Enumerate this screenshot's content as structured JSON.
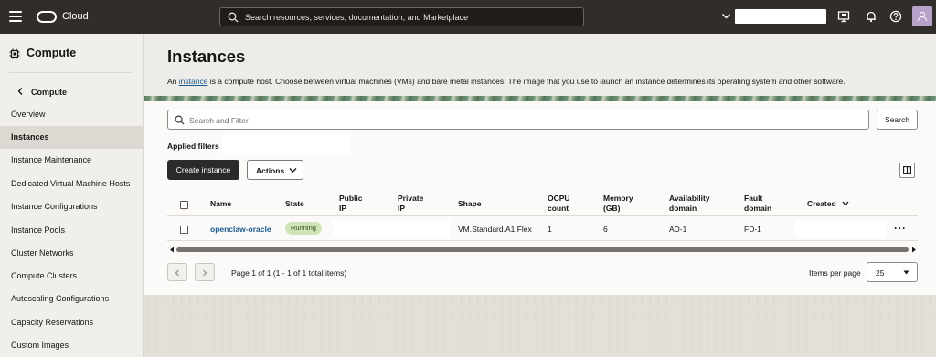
{
  "topbar": {
    "brand": "Cloud",
    "search_placeholder": "Search resources, services, documentation, and Marketplace"
  },
  "sidebar": {
    "title": "Compute",
    "back_label": "Compute",
    "items": [
      {
        "label": "Overview"
      },
      {
        "label": "Instances",
        "active": true
      },
      {
        "label": "Instance Maintenance"
      },
      {
        "label": "Dedicated Virtual Machine Hosts"
      },
      {
        "label": "Instance Configurations"
      },
      {
        "label": "Instance Pools"
      },
      {
        "label": "Cluster Networks"
      },
      {
        "label": "Compute Clusters"
      },
      {
        "label": "Autoscaling Configurations"
      },
      {
        "label": "Capacity Reservations"
      },
      {
        "label": "Custom Images"
      }
    ]
  },
  "main": {
    "title": "Instances",
    "desc_prefix": "An ",
    "desc_link": "instance",
    "desc_suffix": " is a compute host. Choose between virtual machines (VMs) and bare metal instances. The image that you use to launch an instance determines its operating system and other software.",
    "filter_placeholder": "Search and Filter",
    "search_button": "Search",
    "applied_filters_label": "Applied filters",
    "create_button": "Create instance",
    "actions_button": "Actions"
  },
  "table": {
    "headers": {
      "name": "Name",
      "state": "State",
      "public_ip_1": "Public",
      "public_ip_2": "IP",
      "private_ip_1": "Private",
      "private_ip_2": "IP",
      "shape": "Shape",
      "ocpu_1": "OCPU",
      "ocpu_2": "count",
      "memory_1": "Memory",
      "memory_2": "(GB)",
      "ad_1": "Availability",
      "ad_2": "domain",
      "fd_1": "Fault",
      "fd_2": "domain",
      "created": "Created"
    },
    "rows": [
      {
        "name": "openclaw-oracle",
        "state": "Running",
        "shape": "VM.Standard.A1.Flex",
        "ocpu": "1",
        "memory": "6",
        "ad": "AD-1",
        "fd": "FD-1",
        "menu": "···"
      }
    ]
  },
  "pagination": {
    "text": "Page 1 of 1 (1 - 1 of 1 total items)",
    "items_per_page_label": "Items per page",
    "items_per_page_value": "25"
  },
  "colors": {
    "topbar": "#312d2a",
    "primary_button": "#2c2a28",
    "link": "#1b5a8f",
    "running_badge": "#cfe4b8"
  },
  "icons": [
    "menu-icon",
    "oracle-logo-icon",
    "search-icon",
    "chevron-down-icon",
    "console-icon",
    "bell-icon",
    "help-icon",
    "avatar-icon",
    "compute-icon",
    "chevron-left-icon",
    "panel-icon",
    "ellipsis-icon"
  ]
}
